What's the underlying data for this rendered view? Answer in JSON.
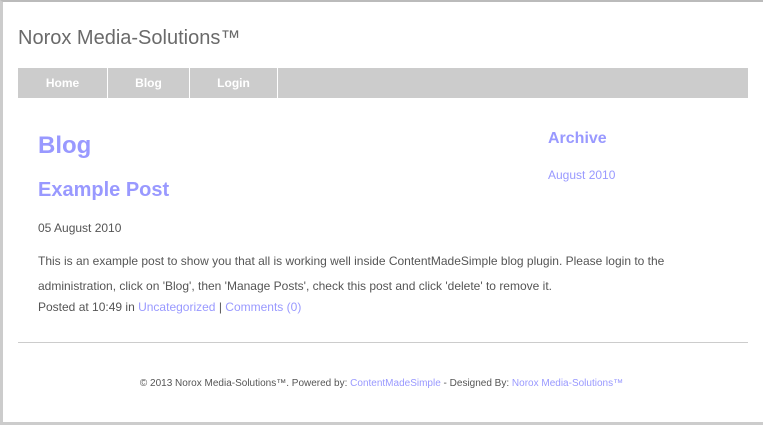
{
  "site_title": "Norox Media-Solutions™",
  "nav": [
    {
      "label": "Home"
    },
    {
      "label": "Blog"
    },
    {
      "label": "Login"
    }
  ],
  "main": {
    "heading": "Blog",
    "post_title": "Example Post",
    "date": "05 August 2010",
    "body": "This is an example post to show you that all is working well inside ContentMadeSimple blog plugin. Please login to the administration, click on 'Blog', then 'Manage Posts', check this post and click 'delete' to remove it.",
    "posted_prefix": "Posted at 10:49 in",
    "category": "Uncategorized",
    "separator": "|",
    "comments": "Comments (0)"
  },
  "sidebar": {
    "heading": "Archive",
    "link": "August 2010"
  },
  "footer": {
    "copyright": "© 2013 Norox Media-Solutions™. Powered by:",
    "cms": "ContentMadeSimple",
    "designed": "- Designed By:",
    "designer": "Norox Media-Solutions™"
  }
}
